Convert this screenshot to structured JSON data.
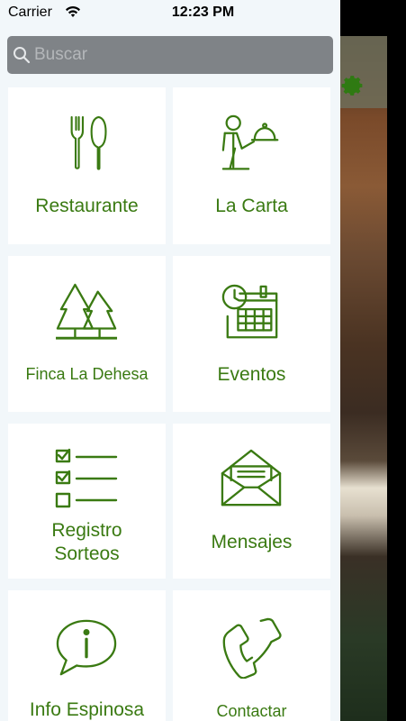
{
  "status_bar": {
    "carrier": "Carrier",
    "time": "12:23 PM"
  },
  "search": {
    "placeholder": "Buscar",
    "value": ""
  },
  "colors": {
    "accent_green": "#3a7a12",
    "drawer_background": "#f2f7fa",
    "tile_background": "#ffffff",
    "search_background": "#7f8387"
  },
  "menu": {
    "items": [
      {
        "label": "Restaurante",
        "icon": "fork-knife-icon"
      },
      {
        "label": "La Carta",
        "icon": "waiter-icon"
      },
      {
        "label": "Finca La Dehesa",
        "icon": "trees-icon"
      },
      {
        "label": "Eventos",
        "icon": "calendar-clock-icon"
      },
      {
        "label": "Registro Sorteos",
        "icon": "checklist-icon"
      },
      {
        "label": "Mensajes",
        "icon": "envelope-icon"
      },
      {
        "label": "Info Espinosa",
        "icon": "info-bubble-icon"
      },
      {
        "label": "Contactar",
        "icon": "phone-icon"
      }
    ]
  }
}
